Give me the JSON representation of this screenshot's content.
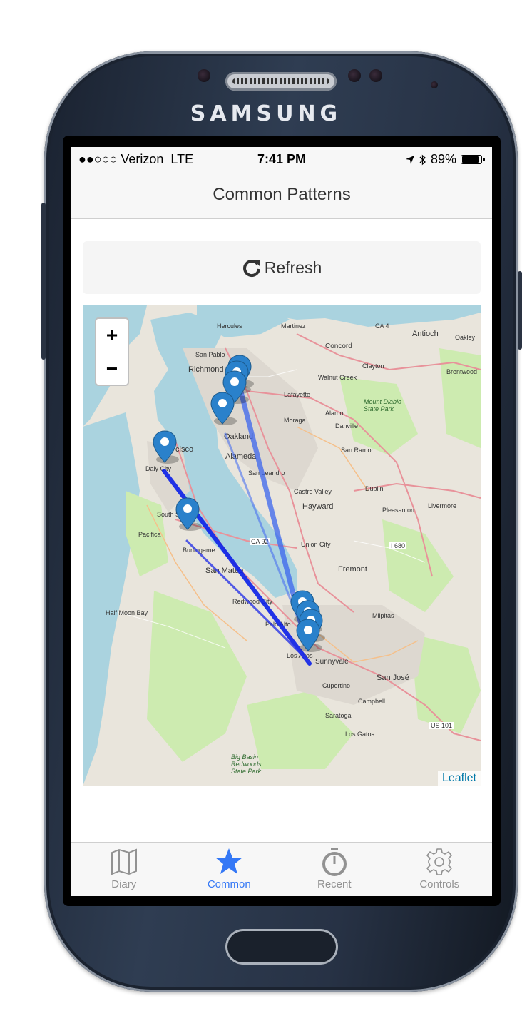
{
  "device": {
    "brand": "SAMSUNG"
  },
  "statusbar": {
    "carrier": "●●○○○ Verizon",
    "network": "LTE",
    "time": "7:41 PM",
    "battery": "89%",
    "battery_level": 0.89
  },
  "navbar": {
    "title": "Common Patterns"
  },
  "refresh": {
    "label": "Refresh",
    "icon": "refresh-icon"
  },
  "map": {
    "zoom_in": "+",
    "zoom_out": "−",
    "attribution": "Leaflet",
    "labels": {
      "richmond": "Richmond",
      "oakland": "Oakland",
      "alameda": "Alameda",
      "sf": "cisco",
      "daly": "Daly City",
      "sansa": "South S",
      "pacifica": "Pacifica",
      "burl": "Burlingame",
      "sanmateo": "San Mateo",
      "halfmoon": "Half Moon Bay",
      "hayward": "Hayward",
      "fremont": "Fremont",
      "sunnyvale": "Sunnyvale",
      "sanjose": "San José",
      "concord": "Concord",
      "antioch": "Antioch",
      "walnut": "Walnut Creek",
      "danville": "Danville",
      "dublin": "Dublin",
      "pleasanton": "Pleasanton",
      "livermore": "Livermore",
      "paloalto": "Palo Alto",
      "cupertino": "Cupertino",
      "campbell": "Campbell",
      "saratoga": "Saratoga",
      "losgatos": "Los Gatos",
      "milpitas": "Milpitas",
      "castro": "Castro Valley",
      "sanleandro": "San Leandro",
      "unioncity": "Union City",
      "redwood": "Redwood City",
      "sanramon": "San Ramon",
      "berkeley": "Hercules",
      "martinez": "Martinez",
      "moraga": "Moraga",
      "lafayette": "Lafayette",
      "alamo": "Alamo",
      "clayton": "Clayton",
      "mtdiablo": "Mount Diablo State Park",
      "ca92": "CA 92",
      "i680": "I 680",
      "us101": "US 101",
      "ca4": "CA 4",
      "bigbasin": "Big Basin Redwoods State Park",
      "losaltos": "Los Altos",
      "sanpablo": "San Pablo",
      "oakley": "Oakley",
      "brentwood": "Brentwood"
    }
  },
  "tabs": [
    {
      "label": "Diary",
      "icon": "map-icon",
      "active": false
    },
    {
      "label": "Common",
      "icon": "star-icon",
      "active": true
    },
    {
      "label": "Recent",
      "icon": "stopwatch-icon",
      "active": false
    },
    {
      "label": "Controls",
      "icon": "gear-icon",
      "active": false
    }
  ],
  "colors": {
    "accent": "#3478f6",
    "route": "#1f3df0",
    "marker": "#2a81cb",
    "inactive_tab": "#929292"
  }
}
